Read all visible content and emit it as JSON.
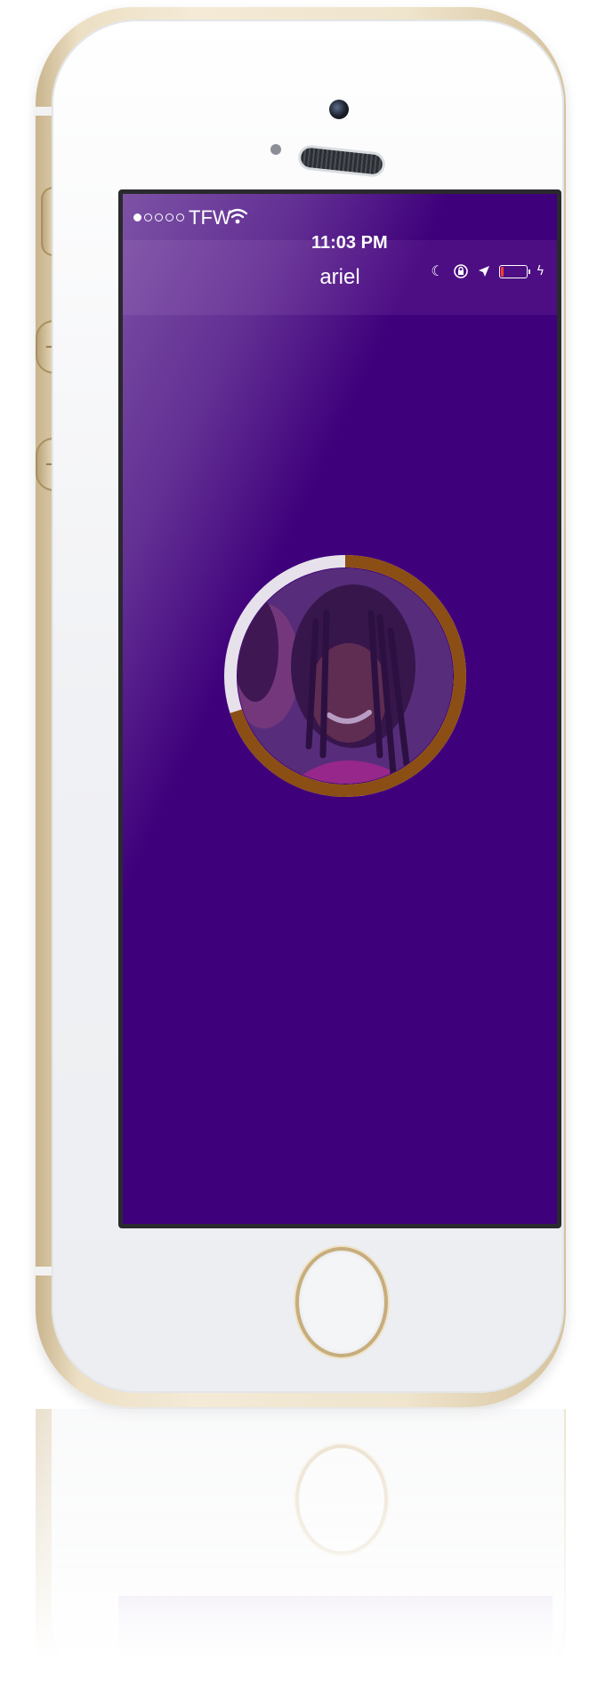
{
  "status_bar": {
    "carrier": "TFW",
    "time": "11:03 PM",
    "signal_strength": 1,
    "signal_max": 5,
    "battery_level": 0.12,
    "icons": [
      "wifi-icon",
      "moon-icon",
      "rotation-lock-icon",
      "location-arrow-icon",
      "battery-icon",
      "charging-bolt-icon"
    ]
  },
  "nav": {
    "title": "ariel"
  },
  "profile": {
    "progress": 0.7,
    "avatar_icon": "profile-photo"
  },
  "colors": {
    "screen_background": "#3f007b",
    "progress_ring": "#8b4e14",
    "progress_track": "#e6e1ea",
    "battery_fill": "#ff3b30",
    "device_gold": "#e9dcc0"
  }
}
